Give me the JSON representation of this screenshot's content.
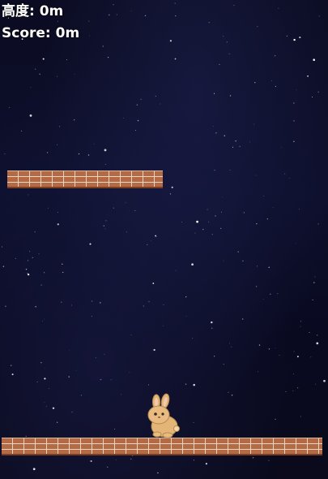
{
  "hud": {
    "height_label": "高度: 0m",
    "score_label": "Score: 0m"
  },
  "colors": {
    "sky": "#0d0f2c",
    "brick": "#b46a45",
    "mortar": "#e8d6c4",
    "bunny": "#e3b577"
  },
  "sprites": {
    "player": "rabbit-icon",
    "platform": "brick-platform"
  }
}
